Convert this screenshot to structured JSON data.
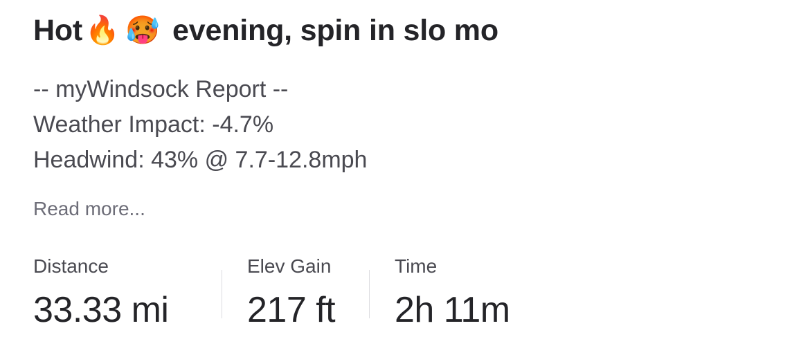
{
  "activity": {
    "title_before": "Hot",
    "emoji_1": "🔥",
    "emoji_2": "🥵",
    "title_after": "evening, spin in slo mo",
    "description_lines": [
      "-- myWindsock Report --",
      "Weather Impact: -4.7%",
      "Headwind: 43% @ 7.7-12.8mph"
    ],
    "read_more": "Read more..."
  },
  "stats": [
    {
      "label": "Distance",
      "value": "33.33 mi"
    },
    {
      "label": "Elev Gain",
      "value": "217 ft"
    },
    {
      "label": "Time",
      "value": "2h 11m"
    }
  ],
  "colors": {
    "title": "#242428",
    "description": "#4a4a51",
    "read_more": "#6d6d78",
    "divider": "#dcdce0",
    "background": "#ffffff"
  },
  "icons": [
    "fire-emoji-icon",
    "hot-face-emoji-icon"
  ]
}
